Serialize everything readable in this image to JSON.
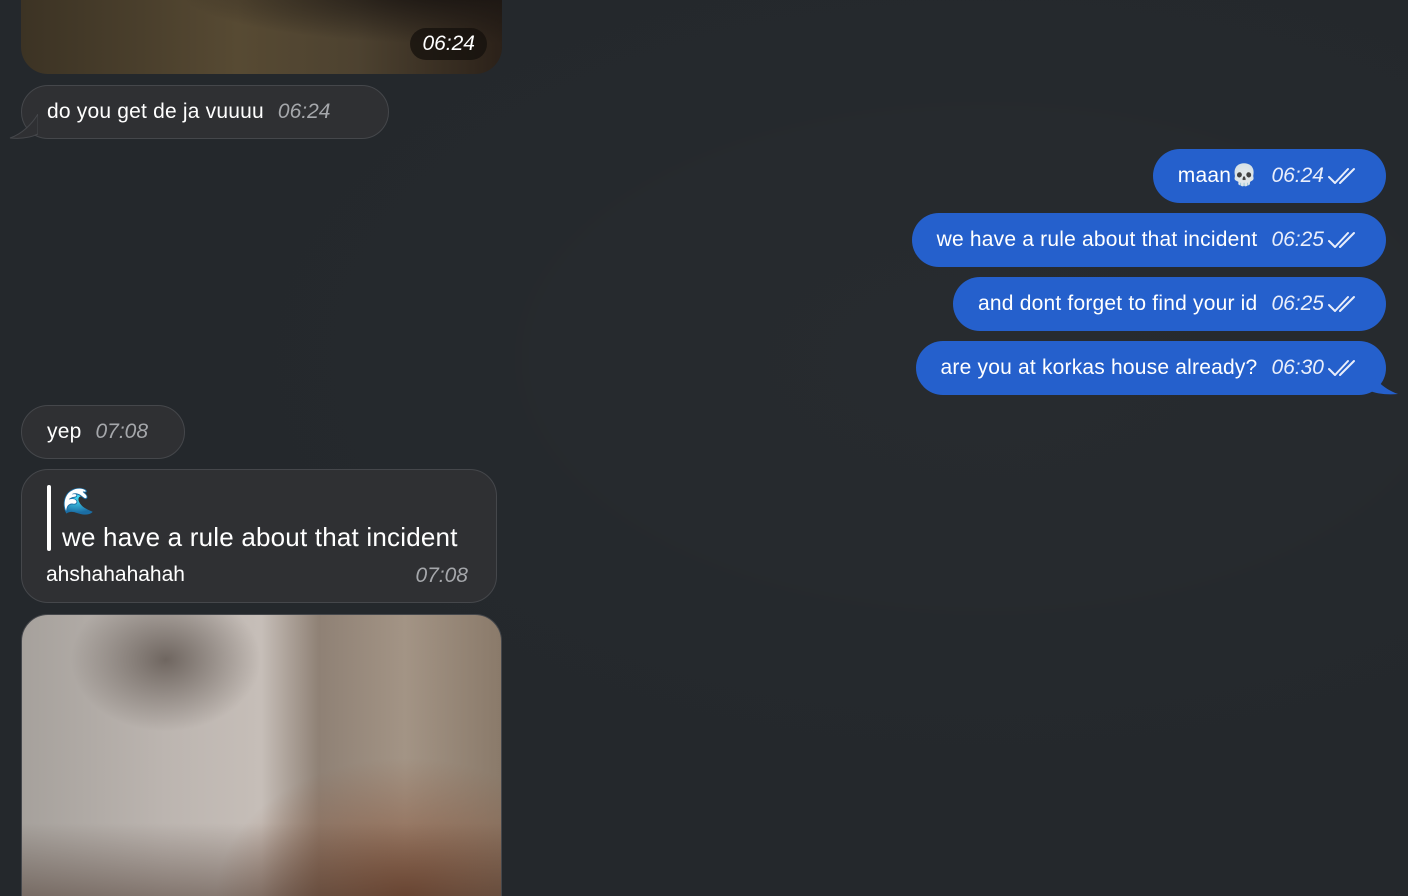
{
  "incoming": {
    "media_top_time": "06:24",
    "message1": {
      "text": "do you get de ja vuuuu",
      "time": "06:24"
    },
    "message2": {
      "text": "yep",
      "time": "07:08"
    },
    "reply_message": {
      "quote_emoji": "🌊",
      "quote_text": "we have a rule about that incident",
      "text": "ahshahahahah",
      "time": "07:08"
    }
  },
  "outgoing": [
    {
      "text": "maan💀",
      "time": "06:24"
    },
    {
      "text": "we have a rule about that incident",
      "time": "06:25"
    },
    {
      "text": "and dont forget to find your id",
      "time": "06:25"
    },
    {
      "text": "are you at korkas house already?",
      "time": "06:30"
    }
  ],
  "colors": {
    "background": "#24282c",
    "incoming_bubble": "#2f3033",
    "outgoing_bubble": "#2560cc"
  },
  "icons": [
    "double-check-icon",
    "bubble-tail-icon"
  ]
}
